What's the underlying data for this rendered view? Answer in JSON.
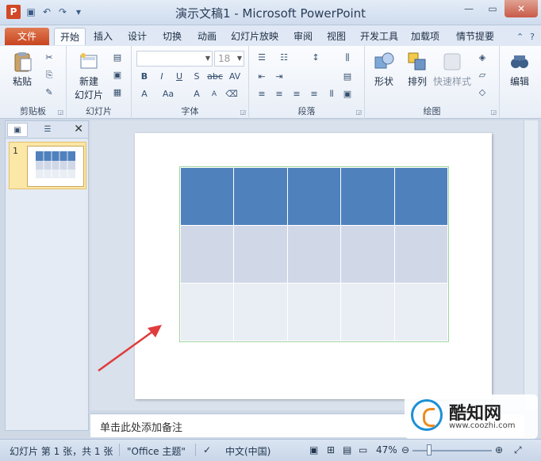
{
  "titlebar": {
    "app_icon": "P",
    "title": "演示文稿1 - Microsoft PowerPoint"
  },
  "tabs": [
    {
      "label": "文件"
    },
    {
      "label": "开始"
    },
    {
      "label": "插入"
    },
    {
      "label": "设计"
    },
    {
      "label": "切换"
    },
    {
      "label": "动画"
    },
    {
      "label": "幻灯片放映"
    },
    {
      "label": "审阅"
    },
    {
      "label": "视图"
    },
    {
      "label": "开发工具"
    },
    {
      "label": "加载项"
    },
    {
      "label": "情节提要"
    }
  ],
  "ribbon": {
    "clipboard": {
      "paste": "粘贴",
      "label": "剪贴板"
    },
    "slides": {
      "new_slide_line1": "新建",
      "new_slide_line2": "幻灯片",
      "label": "幻灯片"
    },
    "font": {
      "size": "18",
      "label": "字体",
      "bold": "B",
      "italic": "I",
      "underline": "U",
      "strike": "S",
      "abc": "abc",
      "spacing": "AV",
      "grow": "A",
      "shrink": "A",
      "clear": "A",
      "case": "Aa"
    },
    "paragraph": {
      "label": "段落"
    },
    "drawing": {
      "shapes": "形状",
      "arrange": "排列",
      "quick_styles": "快速样式",
      "label": "绘图"
    },
    "editing": {
      "label": "编辑"
    }
  },
  "slides_panel": {
    "slide_number": "1"
  },
  "table": {
    "rows": 3,
    "cols": 5
  },
  "notes": {
    "placeholder": "单击此处添加备注"
  },
  "statusbar": {
    "slide_info": "幻灯片 第 1 张，共 1 张",
    "theme": "\"Office 主题\"",
    "language": "中文(中国)",
    "zoom": "47%"
  },
  "watermark": {
    "name": "酷知网",
    "url": "www.coozhi.com"
  },
  "colors": {
    "accent": "#4f81bd",
    "file_tab": "#c8451f",
    "arrow": "#e03c3c"
  }
}
